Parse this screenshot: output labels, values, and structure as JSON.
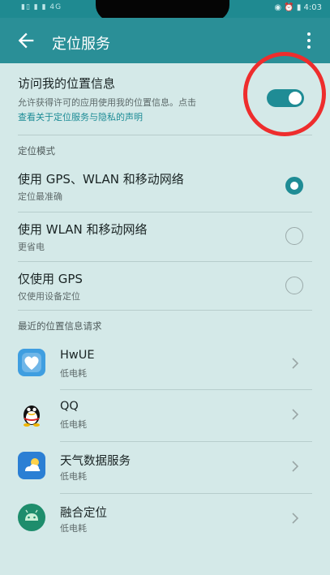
{
  "status_bar": {
    "left_text": "▮▯ ▮ ▮ 4G",
    "right_text": "◉ ⏰ ▮ 4:03"
  },
  "app_bar": {
    "title": "定位服务",
    "back_icon": "arrow-left-icon",
    "menu_icon": "more-vertical-icon"
  },
  "location_access": {
    "title": "访问我的位置信息",
    "description": "允许获得许可的应用使用我的位置信息。点击",
    "link_text": "查看关于定位服务与隐私的声明",
    "enabled": true
  },
  "mode_section": {
    "header": "定位模式",
    "options": [
      {
        "title": "使用 GPS、WLAN 和移动网络",
        "subtitle": "定位最准确",
        "selected": true
      },
      {
        "title": "使用 WLAN 和移动网络",
        "subtitle": "更省电",
        "selected": false
      },
      {
        "title": "仅使用 GPS",
        "subtitle": "仅使用设备定位",
        "selected": false
      }
    ]
  },
  "recent_section": {
    "header": "最近的位置信息请求",
    "apps": [
      {
        "name": "HwUE",
        "subtitle": "低电耗",
        "icon": "hwue-heart-icon"
      },
      {
        "name": "QQ",
        "subtitle": "低电耗",
        "icon": "qq-penguin-icon"
      },
      {
        "name": "天气数据服务",
        "subtitle": "低电耗",
        "icon": "weather-icon"
      },
      {
        "name": "融合定位",
        "subtitle": "低电耗",
        "icon": "android-icon"
      }
    ]
  },
  "colors": {
    "accent": "#1f8c95",
    "annotation": "#ee2d2d",
    "background": "#d4e9e8"
  }
}
